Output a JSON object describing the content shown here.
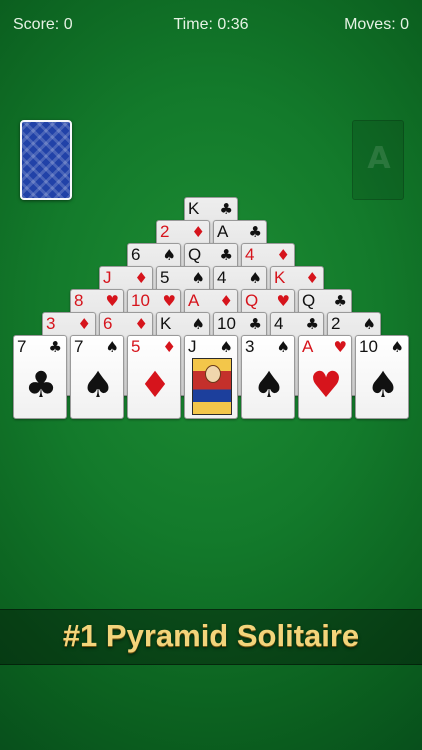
{
  "status": {
    "score": "Score: 0",
    "time": "Time: 0:36",
    "moves": "Moves: 0"
  },
  "foundation": {
    "label": "A"
  },
  "colors": {
    "felt": "#137a2b",
    "card_back": "#2142a8",
    "red_suit": "#d6141c",
    "banner_text": "#f3d47b"
  },
  "pyramid": [
    [
      {
        "rank": "K",
        "suit": "♣"
      }
    ],
    [
      {
        "rank": "2",
        "suit": "♦"
      },
      {
        "rank": "A",
        "suit": "♣"
      }
    ],
    [
      {
        "rank": "6",
        "suit": "♠"
      },
      {
        "rank": "Q",
        "suit": "♣"
      },
      {
        "rank": "4",
        "suit": "♦"
      }
    ],
    [
      {
        "rank": "J",
        "suit": "♦"
      },
      {
        "rank": "5",
        "suit": "♠"
      },
      {
        "rank": "4",
        "suit": "♠"
      },
      {
        "rank": "K",
        "suit": "♦"
      }
    ],
    [
      {
        "rank": "8",
        "suit": "♥"
      },
      {
        "rank": "10",
        "suit": "♥"
      },
      {
        "rank": "A",
        "suit": "♦"
      },
      {
        "rank": "Q",
        "suit": "♥"
      },
      {
        "rank": "Q",
        "suit": "♣"
      }
    ],
    [
      {
        "rank": "3",
        "suit": "♦"
      },
      {
        "rank": "6",
        "suit": "♦"
      },
      {
        "rank": "K",
        "suit": "♠"
      },
      {
        "rank": "10",
        "suit": "♣"
      },
      {
        "rank": "4",
        "suit": "♣"
      },
      {
        "rank": "2",
        "suit": "♠"
      }
    ],
    [
      {
        "rank": "7",
        "suit": "♣"
      },
      {
        "rank": "7",
        "suit": "♠"
      },
      {
        "rank": "5",
        "suit": "♦"
      },
      {
        "rank": "J",
        "suit": "♠"
      },
      {
        "rank": "3",
        "suit": "♠"
      },
      {
        "rank": "A",
        "suit": "♥"
      },
      {
        "rank": "10",
        "suit": "♠"
      }
    ]
  ],
  "banner": {
    "title": "#1 Pyramid Solitaire"
  }
}
